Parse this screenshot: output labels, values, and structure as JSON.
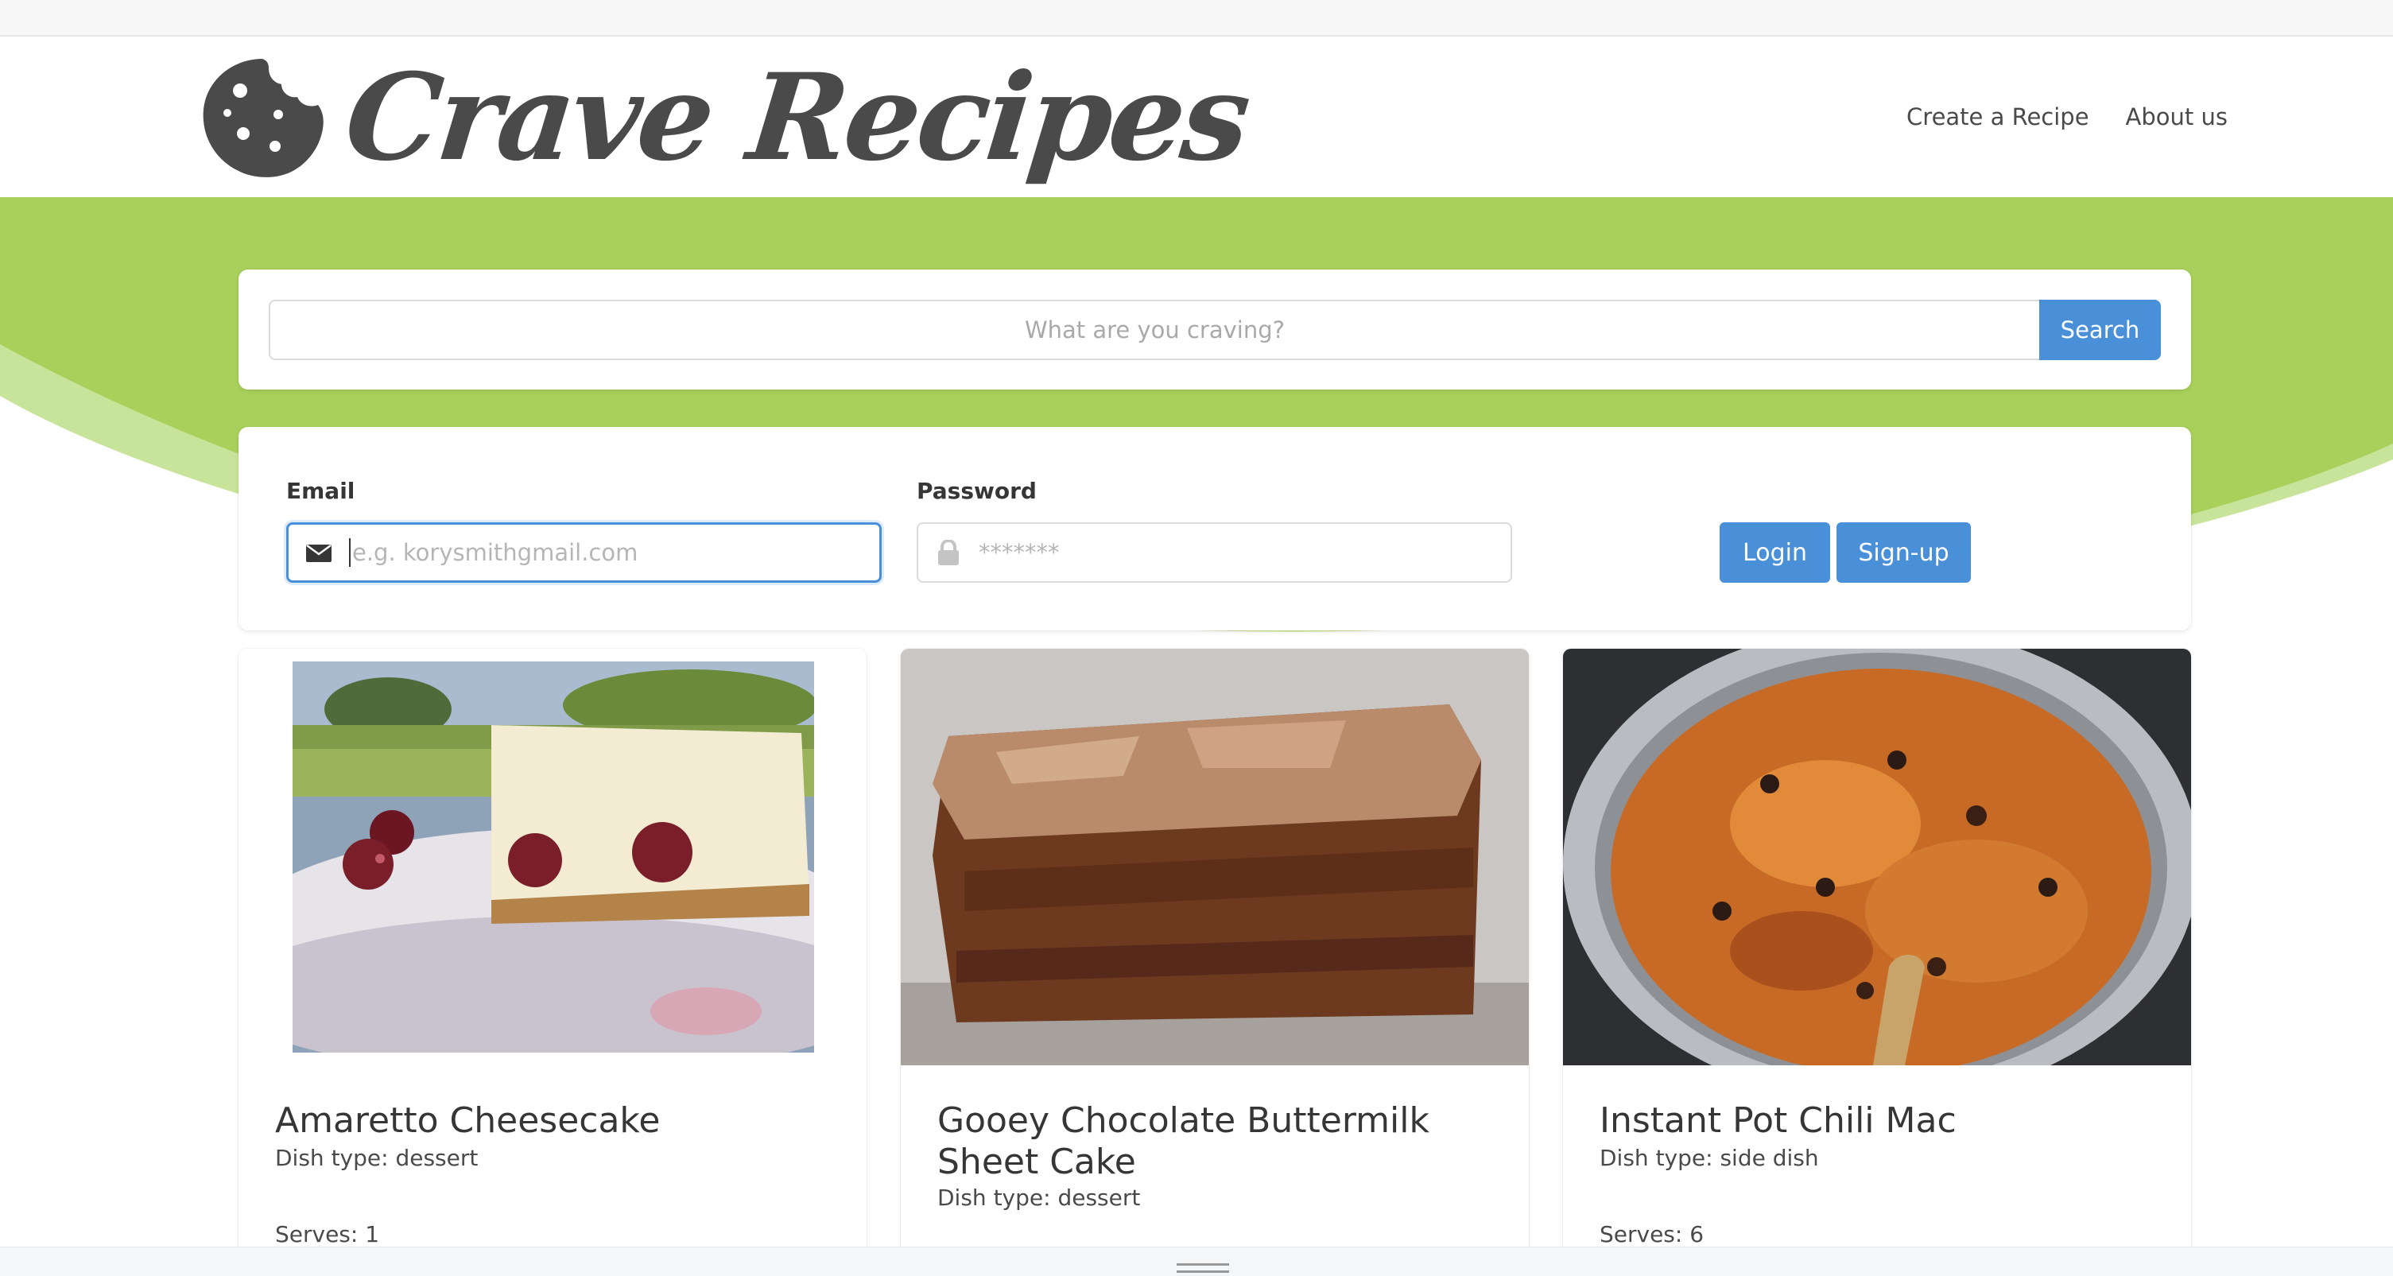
{
  "brand": {
    "name": "Crave Recipes",
    "logo_icon": "cookie-icon"
  },
  "nav": {
    "links": [
      "Create a Recipe",
      "About us"
    ]
  },
  "search": {
    "placeholder": "What are you craving?",
    "button": "Search"
  },
  "login": {
    "email_label": "Email",
    "email_placeholder": "e.g. korysmithgmail.com",
    "email_icon": "envelope-icon",
    "password_label": "Password",
    "password_placeholder": "*******",
    "password_icon": "lock-icon",
    "login_button": "Login",
    "signup_button": "Sign-up"
  },
  "recipes": [
    {
      "title": "Amaretto Cheesecake",
      "dish_type": "Dish type: dessert",
      "serves": "Serves: 1",
      "image": "cheesecake-photo"
    },
    {
      "title": "Gooey Chocolate Buttermilk Sheet Cake",
      "dish_type": "Dish type: dessert",
      "serves": "",
      "image": "sheet-cake-photo"
    },
    {
      "title": "Instant Pot Chili Mac",
      "dish_type": "Dish type: side dish",
      "serves": "Serves: 6",
      "image": "chili-mac-photo"
    }
  ],
  "colors": {
    "accent": "#4a90d9",
    "hero_green": "#a8d05a",
    "hero_light": "#c8e39a",
    "text": "#363636"
  }
}
